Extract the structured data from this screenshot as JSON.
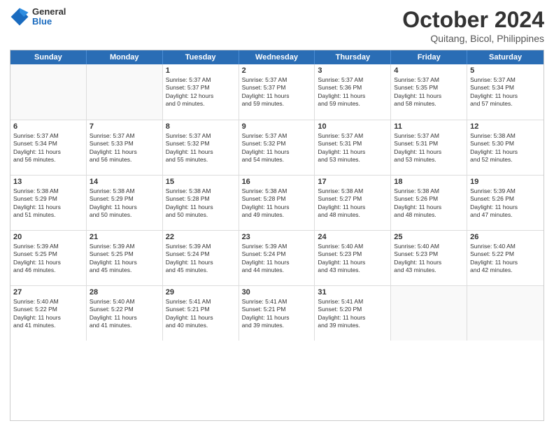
{
  "header": {
    "logo_general": "General",
    "logo_blue": "Blue",
    "month_title": "October 2024",
    "location": "Quitang, Bicol, Philippines"
  },
  "days_of_week": [
    "Sunday",
    "Monday",
    "Tuesday",
    "Wednesday",
    "Thursday",
    "Friday",
    "Saturday"
  ],
  "weeks": [
    [
      {
        "day": "",
        "lines": []
      },
      {
        "day": "",
        "lines": []
      },
      {
        "day": "1",
        "lines": [
          "Sunrise: 5:37 AM",
          "Sunset: 5:37 PM",
          "Daylight: 12 hours",
          "and 0 minutes."
        ]
      },
      {
        "day": "2",
        "lines": [
          "Sunrise: 5:37 AM",
          "Sunset: 5:37 PM",
          "Daylight: 11 hours",
          "and 59 minutes."
        ]
      },
      {
        "day": "3",
        "lines": [
          "Sunrise: 5:37 AM",
          "Sunset: 5:36 PM",
          "Daylight: 11 hours",
          "and 59 minutes."
        ]
      },
      {
        "day": "4",
        "lines": [
          "Sunrise: 5:37 AM",
          "Sunset: 5:35 PM",
          "Daylight: 11 hours",
          "and 58 minutes."
        ]
      },
      {
        "day": "5",
        "lines": [
          "Sunrise: 5:37 AM",
          "Sunset: 5:34 PM",
          "Daylight: 11 hours",
          "and 57 minutes."
        ]
      }
    ],
    [
      {
        "day": "6",
        "lines": [
          "Sunrise: 5:37 AM",
          "Sunset: 5:34 PM",
          "Daylight: 11 hours",
          "and 56 minutes."
        ]
      },
      {
        "day": "7",
        "lines": [
          "Sunrise: 5:37 AM",
          "Sunset: 5:33 PM",
          "Daylight: 11 hours",
          "and 56 minutes."
        ]
      },
      {
        "day": "8",
        "lines": [
          "Sunrise: 5:37 AM",
          "Sunset: 5:32 PM",
          "Daylight: 11 hours",
          "and 55 minutes."
        ]
      },
      {
        "day": "9",
        "lines": [
          "Sunrise: 5:37 AM",
          "Sunset: 5:32 PM",
          "Daylight: 11 hours",
          "and 54 minutes."
        ]
      },
      {
        "day": "10",
        "lines": [
          "Sunrise: 5:37 AM",
          "Sunset: 5:31 PM",
          "Daylight: 11 hours",
          "and 53 minutes."
        ]
      },
      {
        "day": "11",
        "lines": [
          "Sunrise: 5:37 AM",
          "Sunset: 5:31 PM",
          "Daylight: 11 hours",
          "and 53 minutes."
        ]
      },
      {
        "day": "12",
        "lines": [
          "Sunrise: 5:38 AM",
          "Sunset: 5:30 PM",
          "Daylight: 11 hours",
          "and 52 minutes."
        ]
      }
    ],
    [
      {
        "day": "13",
        "lines": [
          "Sunrise: 5:38 AM",
          "Sunset: 5:29 PM",
          "Daylight: 11 hours",
          "and 51 minutes."
        ]
      },
      {
        "day": "14",
        "lines": [
          "Sunrise: 5:38 AM",
          "Sunset: 5:29 PM",
          "Daylight: 11 hours",
          "and 50 minutes."
        ]
      },
      {
        "day": "15",
        "lines": [
          "Sunrise: 5:38 AM",
          "Sunset: 5:28 PM",
          "Daylight: 11 hours",
          "and 50 minutes."
        ]
      },
      {
        "day": "16",
        "lines": [
          "Sunrise: 5:38 AM",
          "Sunset: 5:28 PM",
          "Daylight: 11 hours",
          "and 49 minutes."
        ]
      },
      {
        "day": "17",
        "lines": [
          "Sunrise: 5:38 AM",
          "Sunset: 5:27 PM",
          "Daylight: 11 hours",
          "and 48 minutes."
        ]
      },
      {
        "day": "18",
        "lines": [
          "Sunrise: 5:38 AM",
          "Sunset: 5:26 PM",
          "Daylight: 11 hours",
          "and 48 minutes."
        ]
      },
      {
        "day": "19",
        "lines": [
          "Sunrise: 5:39 AM",
          "Sunset: 5:26 PM",
          "Daylight: 11 hours",
          "and 47 minutes."
        ]
      }
    ],
    [
      {
        "day": "20",
        "lines": [
          "Sunrise: 5:39 AM",
          "Sunset: 5:25 PM",
          "Daylight: 11 hours",
          "and 46 minutes."
        ]
      },
      {
        "day": "21",
        "lines": [
          "Sunrise: 5:39 AM",
          "Sunset: 5:25 PM",
          "Daylight: 11 hours",
          "and 45 minutes."
        ]
      },
      {
        "day": "22",
        "lines": [
          "Sunrise: 5:39 AM",
          "Sunset: 5:24 PM",
          "Daylight: 11 hours",
          "and 45 minutes."
        ]
      },
      {
        "day": "23",
        "lines": [
          "Sunrise: 5:39 AM",
          "Sunset: 5:24 PM",
          "Daylight: 11 hours",
          "and 44 minutes."
        ]
      },
      {
        "day": "24",
        "lines": [
          "Sunrise: 5:40 AM",
          "Sunset: 5:23 PM",
          "Daylight: 11 hours",
          "and 43 minutes."
        ]
      },
      {
        "day": "25",
        "lines": [
          "Sunrise: 5:40 AM",
          "Sunset: 5:23 PM",
          "Daylight: 11 hours",
          "and 43 minutes."
        ]
      },
      {
        "day": "26",
        "lines": [
          "Sunrise: 5:40 AM",
          "Sunset: 5:22 PM",
          "Daylight: 11 hours",
          "and 42 minutes."
        ]
      }
    ],
    [
      {
        "day": "27",
        "lines": [
          "Sunrise: 5:40 AM",
          "Sunset: 5:22 PM",
          "Daylight: 11 hours",
          "and 41 minutes."
        ]
      },
      {
        "day": "28",
        "lines": [
          "Sunrise: 5:40 AM",
          "Sunset: 5:22 PM",
          "Daylight: 11 hours",
          "and 41 minutes."
        ]
      },
      {
        "day": "29",
        "lines": [
          "Sunrise: 5:41 AM",
          "Sunset: 5:21 PM",
          "Daylight: 11 hours",
          "and 40 minutes."
        ]
      },
      {
        "day": "30",
        "lines": [
          "Sunrise: 5:41 AM",
          "Sunset: 5:21 PM",
          "Daylight: 11 hours",
          "and 39 minutes."
        ]
      },
      {
        "day": "31",
        "lines": [
          "Sunrise: 5:41 AM",
          "Sunset: 5:20 PM",
          "Daylight: 11 hours",
          "and 39 minutes."
        ]
      },
      {
        "day": "",
        "lines": []
      },
      {
        "day": "",
        "lines": []
      }
    ]
  ]
}
